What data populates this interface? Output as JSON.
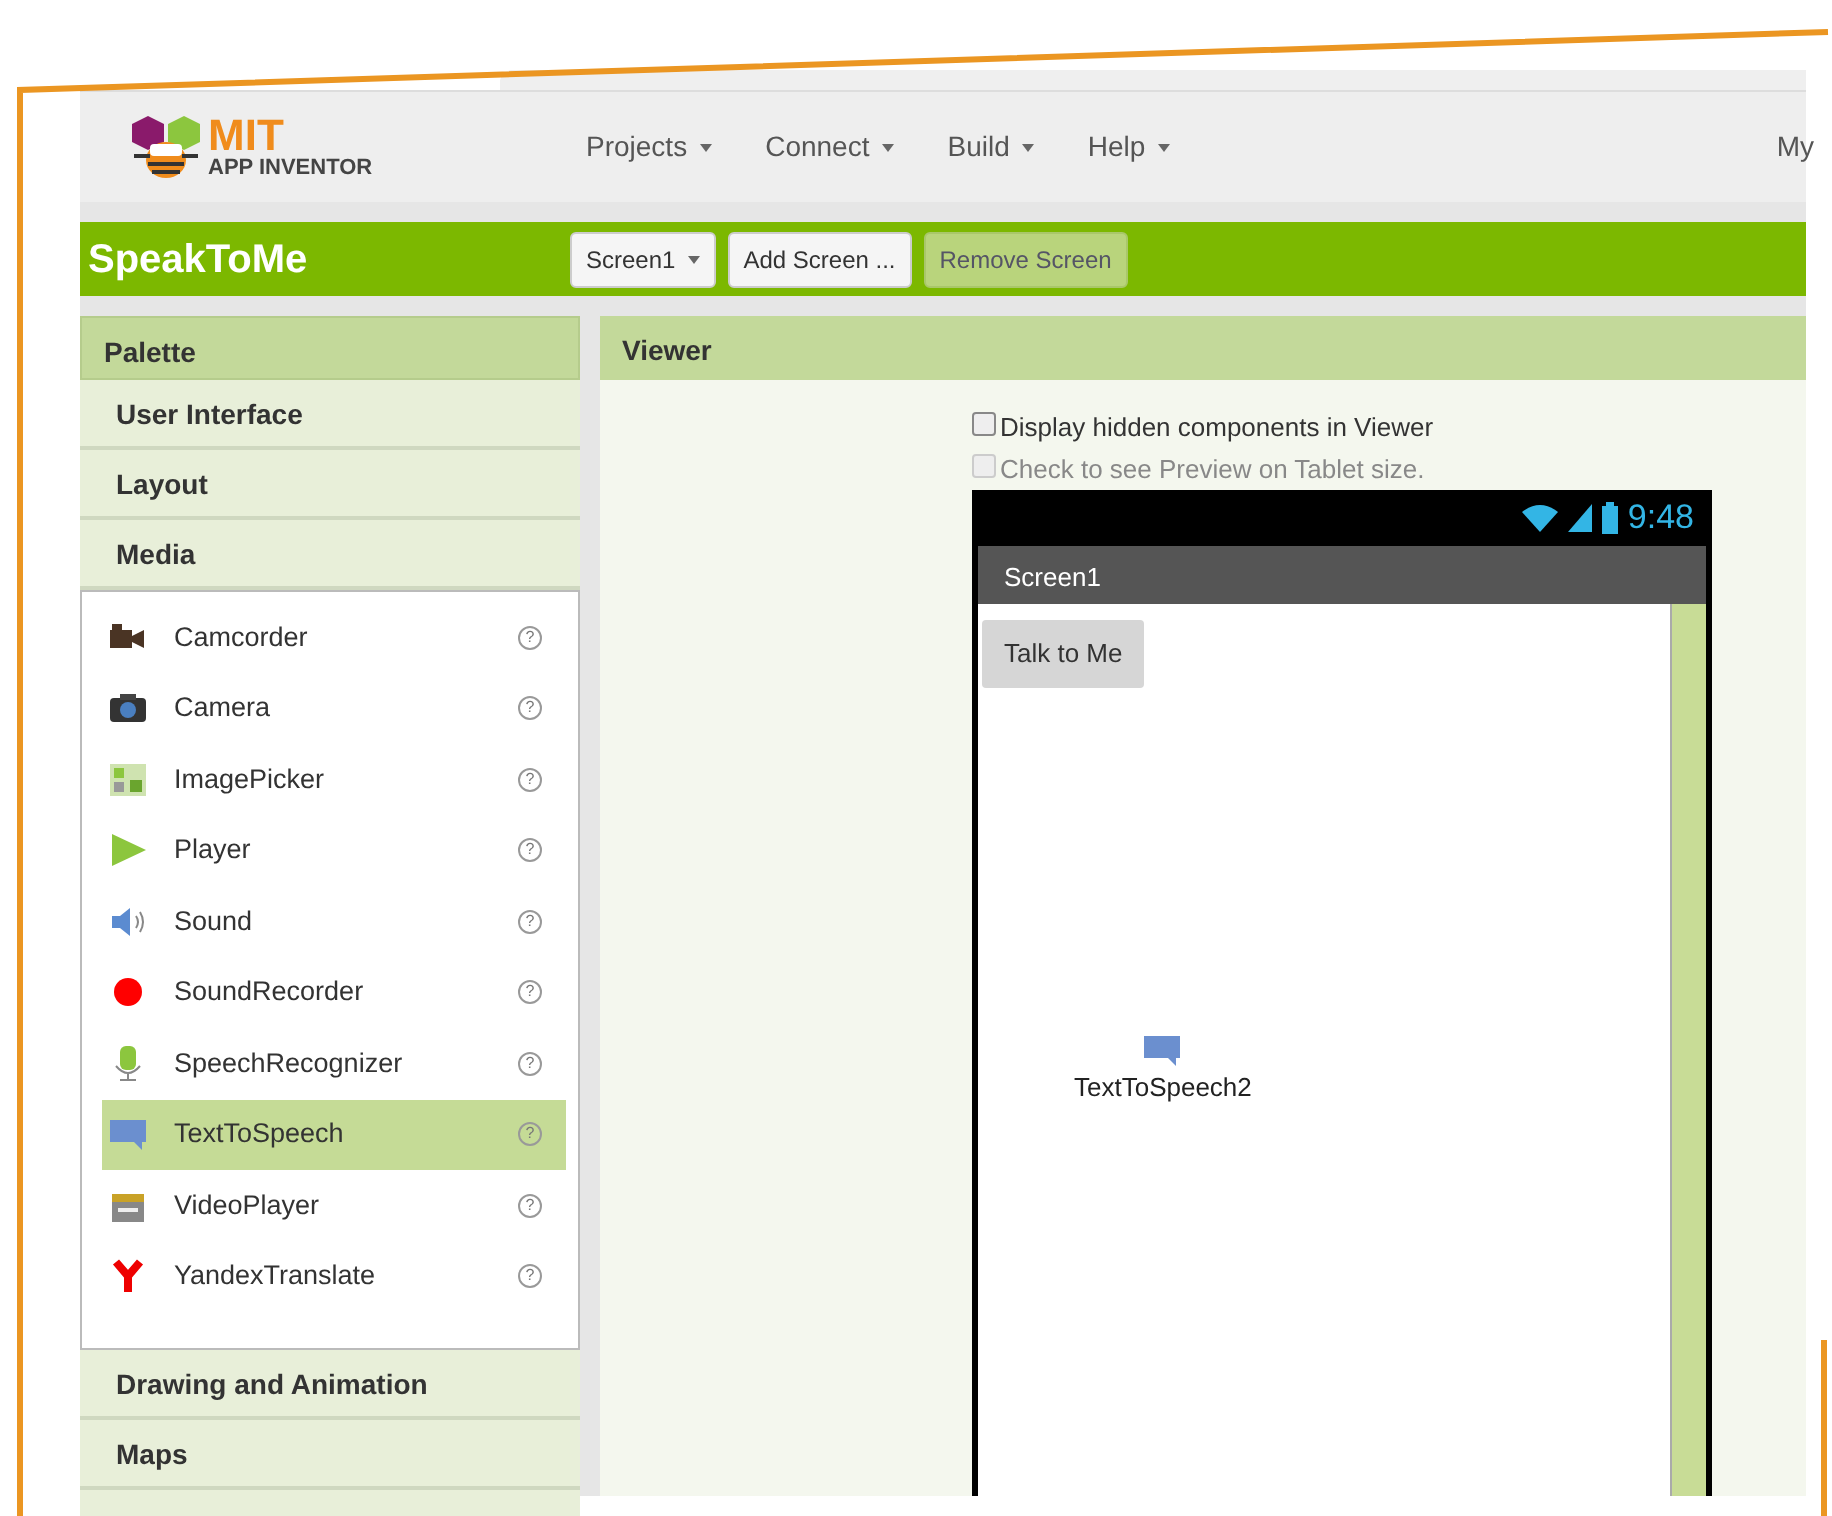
{
  "logo": {
    "line_1": "MIT",
    "line_2": "APP INVENTOR"
  },
  "menus": [
    {
      "label": "Projects"
    },
    {
      "label": "Connect"
    },
    {
      "label": "Build"
    },
    {
      "label": "Help"
    }
  ],
  "header_cut_label": "My",
  "project": {
    "title": "SpeakToMe",
    "buttons": [
      {
        "label": "Screen1",
        "dropdown": true,
        "disabled": false
      },
      {
        "label": "Add Screen ...",
        "dropdown": false,
        "disabled": false
      },
      {
        "label": "Remove Screen",
        "dropdown": false,
        "disabled": true
      }
    ]
  },
  "palette": {
    "title": "Palette",
    "categories": [
      {
        "label": "User Interface"
      },
      {
        "label": "Layout"
      },
      {
        "label": "Media",
        "items": [
          {
            "label": "Camcorder",
            "help": "?",
            "selected": false
          },
          {
            "label": "Camera",
            "help": "?",
            "selected": false
          },
          {
            "label": "ImagePicker",
            "help": "?",
            "selected": false
          },
          {
            "label": "Player",
            "help": "?",
            "selected": false
          },
          {
            "label": "Sound",
            "help": "?",
            "selected": false
          },
          {
            "label": "SoundRecorder",
            "help": "?",
            "selected": false
          },
          {
            "label": "SpeechRecognizer",
            "help": "?",
            "selected": false
          },
          {
            "label": "TextToSpeech",
            "help": "?",
            "selected": true
          },
          {
            "label": "VideoPlayer",
            "help": "?",
            "selected": false
          },
          {
            "label": "YandexTranslate",
            "help": "?",
            "selected": false
          }
        ]
      },
      {
        "label": "Drawing and Animation"
      },
      {
        "label": "Maps"
      }
    ]
  },
  "viewer": {
    "title": "Viewer",
    "options": [
      {
        "label": "Display hidden components in Viewer",
        "checked": false,
        "disabled": false
      },
      {
        "label": "Check to see Preview on Tablet size.",
        "checked": false,
        "disabled": true
      }
    ],
    "phone": {
      "time": "9:48",
      "screen_title": "Screen1",
      "button": "Talk to Me",
      "component": "TextToSpeech2"
    }
  }
}
